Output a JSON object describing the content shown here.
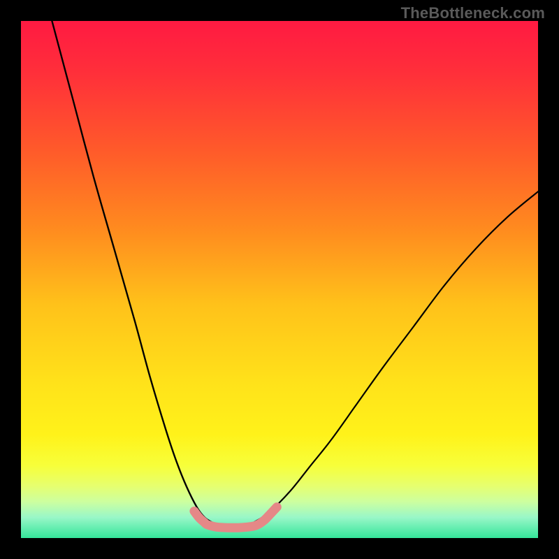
{
  "watermark": {
    "text": "TheBottleneck.com"
  },
  "gradient": {
    "stops": [
      {
        "offset": 0.0,
        "color": "#ff1a42"
      },
      {
        "offset": 0.1,
        "color": "#ff2f3a"
      },
      {
        "offset": 0.25,
        "color": "#ff5a2a"
      },
      {
        "offset": 0.4,
        "color": "#ff8a1f"
      },
      {
        "offset": 0.55,
        "color": "#ffc21a"
      },
      {
        "offset": 0.7,
        "color": "#ffe21a"
      },
      {
        "offset": 0.8,
        "color": "#fff21a"
      },
      {
        "offset": 0.86,
        "color": "#f7ff3a"
      },
      {
        "offset": 0.9,
        "color": "#e6ff70"
      },
      {
        "offset": 0.93,
        "color": "#ccffa0"
      },
      {
        "offset": 0.96,
        "color": "#99f7c8"
      },
      {
        "offset": 1.0,
        "color": "#34e59a"
      }
    ]
  },
  "chart_data": {
    "type": "line",
    "title": "",
    "xlabel": "",
    "ylabel": "",
    "xlim": [
      0,
      100
    ],
    "ylim": [
      0,
      100
    ],
    "series": [
      {
        "name": "left-valley-curve",
        "color": "#000000",
        "width": 2.4,
        "x": [
          6,
          10,
          14,
          18,
          22,
          25,
          28,
          30,
          32,
          34,
          35.5,
          37
        ],
        "y": [
          100,
          85,
          70,
          56,
          42,
          31,
          21,
          15,
          10,
          6,
          4,
          3
        ]
      },
      {
        "name": "right-valley-curve",
        "color": "#000000",
        "width": 2.2,
        "x": [
          45,
          48,
          52,
          56,
          60,
          65,
          70,
          76,
          82,
          88,
          94,
          100
        ],
        "y": [
          3,
          5,
          9,
          14,
          19,
          26,
          33,
          41,
          49,
          56,
          62,
          67
        ]
      },
      {
        "name": "valley-floor-highlight",
        "color": "#e58887",
        "width": 13,
        "x": [
          33.5,
          34.5,
          35.5,
          36,
          37,
          38,
          40,
          42,
          43.5,
          45,
          46,
          47,
          48,
          49.5
        ],
        "y": [
          5.2,
          3.9,
          3.0,
          2.6,
          2.3,
          2.1,
          2.0,
          2.0,
          2.1,
          2.3,
          2.7,
          3.4,
          4.4,
          6.0
        ]
      }
    ]
  }
}
